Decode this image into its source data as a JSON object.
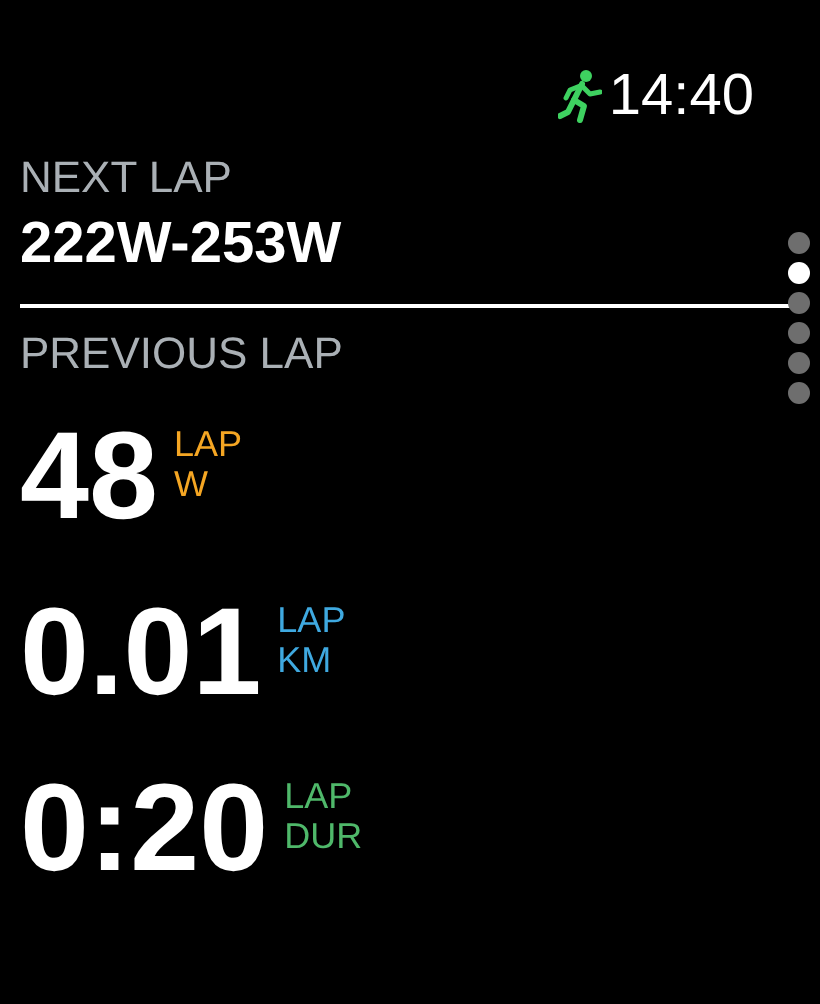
{
  "status": {
    "time": "14:40"
  },
  "next_lap": {
    "label": "NEXT LAP",
    "value": "222W-253W"
  },
  "previous_lap": {
    "label": "PREVIOUS LAP"
  },
  "metrics": [
    {
      "value": "48",
      "unit_top": "LAP",
      "unit_bottom": "W",
      "color": "#f5a623"
    },
    {
      "value": "0.01",
      "unit_top": "LAP",
      "unit_bottom": "KM",
      "color": "#3fa9e0"
    },
    {
      "value": "0:20",
      "unit_top": "LAP",
      "unit_bottom": "DUR",
      "color": "#4fb86a"
    }
  ],
  "pages": [
    {
      "selected": false
    },
    {
      "selected": true
    },
    {
      "selected": false
    },
    {
      "selected": false
    },
    {
      "selected": false
    },
    {
      "selected": false
    }
  ]
}
